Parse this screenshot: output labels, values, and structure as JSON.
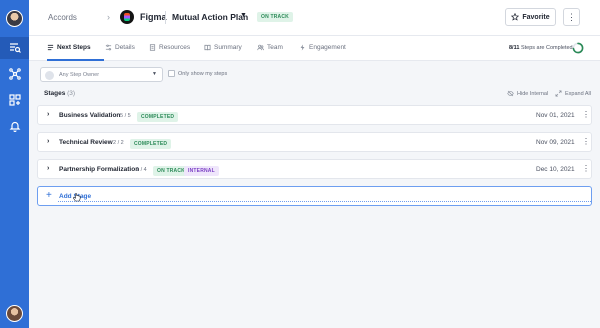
{
  "header": {
    "breadcrumb_root": "Accords",
    "account_name": "Figma",
    "plan_name": "Mutual Action Plan",
    "plan_status": "ON TRACK",
    "favorite_label": "Favorite"
  },
  "tabs": [
    {
      "label": "Next Steps",
      "icon": "list-icon",
      "active": true
    },
    {
      "label": "Details",
      "icon": "sliders-icon",
      "active": false
    },
    {
      "label": "Resources",
      "icon": "document-icon",
      "active": false
    },
    {
      "label": "Summary",
      "icon": "book-icon",
      "active": false
    },
    {
      "label": "Team",
      "icon": "people-icon",
      "active": false
    },
    {
      "label": "Engagement",
      "icon": "bolt-icon",
      "active": false
    }
  ],
  "progress": {
    "completed_fraction": "8/11",
    "suffix": "Steps are Completed",
    "ratio": 0.727
  },
  "filters": {
    "owner_placeholder": "Any Step Owner",
    "only_mine_label": "Only show my steps"
  },
  "stages": {
    "heading": "Stages",
    "count": "(3)",
    "hide_internal": "Hide Internal",
    "expand_all": "Expand All",
    "items": [
      {
        "name": "Business Validation",
        "count": "5 / 5",
        "status": "COMPLETED",
        "status_color": "#2b8a57",
        "tag": "",
        "date": "Nov 01, 2021"
      },
      {
        "name": "Technical Review",
        "count": "2 / 2",
        "status": "COMPLETED",
        "status_color": "#2b8a57",
        "tag": "",
        "date": "Nov 09, 2021"
      },
      {
        "name": "Partnership Formalization",
        "count": "1 / 4",
        "status": "ON TRACK",
        "status_color": "#2b8a57",
        "tag": "INTERNAL",
        "date": "Dec 10, 2021"
      }
    ],
    "add_label": "Add Stage"
  },
  "colors": {
    "accent": "#2f6fd6",
    "success": "#2b8a57",
    "internal": "#7b3fc4"
  }
}
